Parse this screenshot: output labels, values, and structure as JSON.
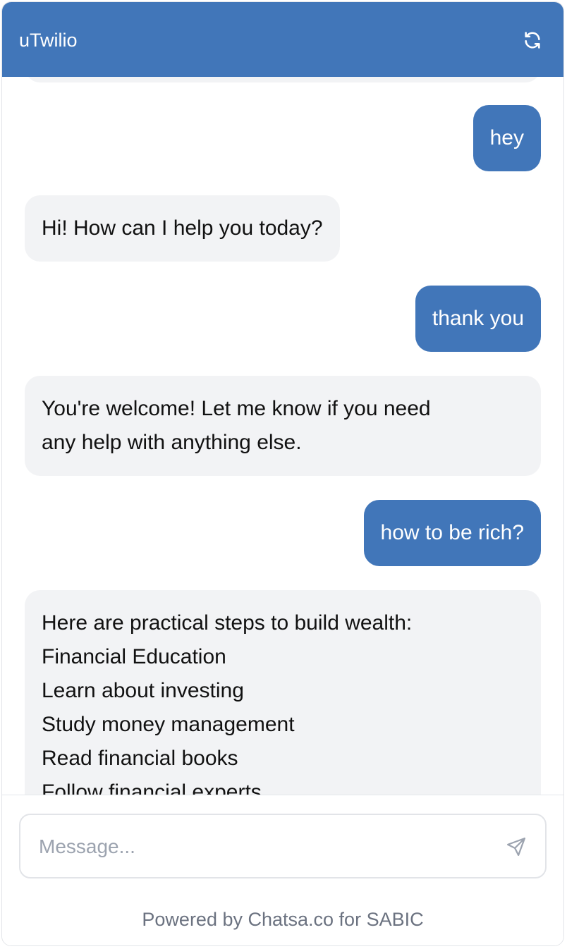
{
  "header": {
    "title": "uTwilio",
    "refresh_icon": "refresh-icon"
  },
  "messages": [
    {
      "role": "user",
      "text": "hey"
    },
    {
      "role": "bot",
      "text": "Hi! How can I help you today?"
    },
    {
      "role": "user",
      "text": "thank you"
    },
    {
      "role": "bot",
      "lines": [
        "You're welcome! Let me know if you need",
        "any help with anything else."
      ]
    },
    {
      "role": "user",
      "text": "how to be rich?"
    },
    {
      "role": "bot",
      "lines": [
        "Here are practical steps to build wealth:",
        "Financial Education",
        "Learn about investing",
        "Study money management",
        "Read financial books",
        "Follow financial experts"
      ]
    }
  ],
  "composer": {
    "placeholder": "Message...",
    "value": "",
    "send_icon": "send-icon"
  },
  "footer": {
    "text": "Powered by Chatsa.co for SABIC"
  },
  "colors": {
    "accent": "#4176b9",
    "bot_bubble": "#f2f3f5",
    "footer_text": "#6b7280"
  }
}
